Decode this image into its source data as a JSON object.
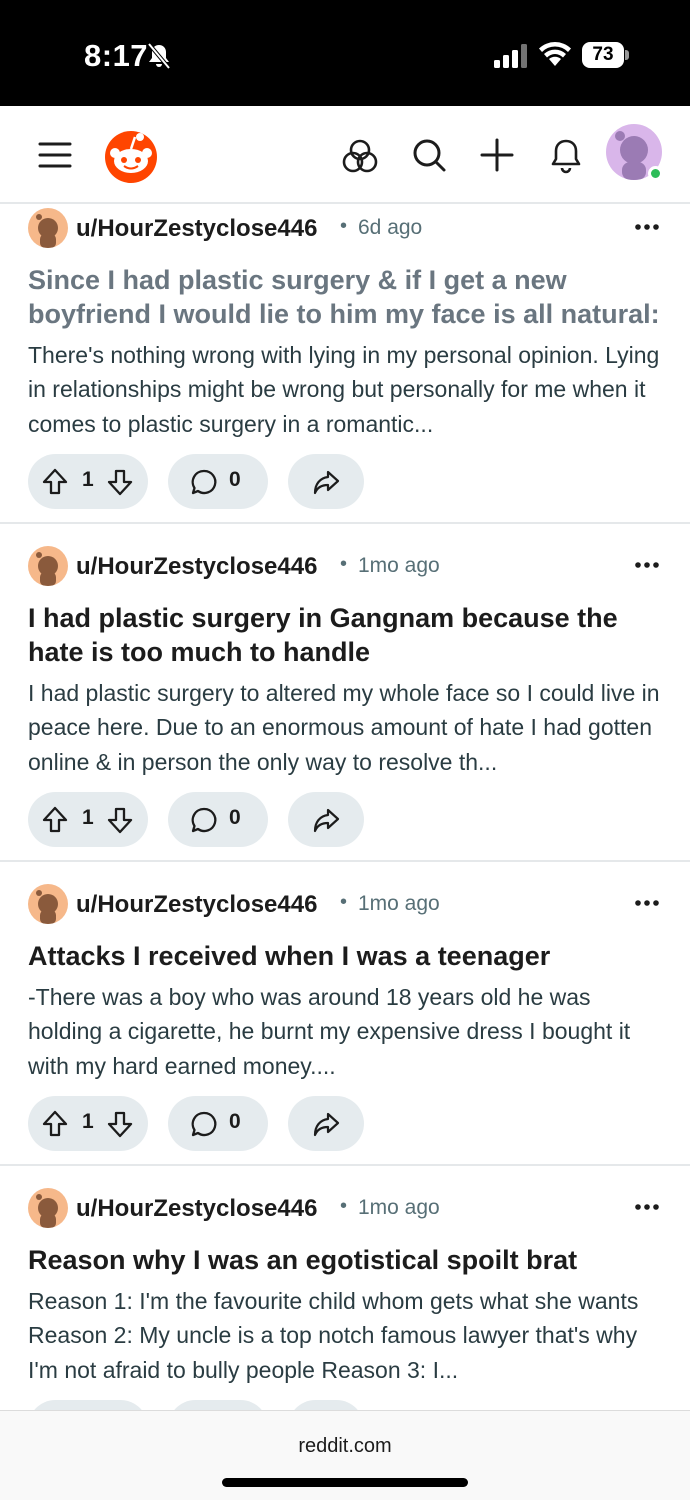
{
  "status_bar": {
    "time": "8:17",
    "battery": "73"
  },
  "header": {
    "menu_icon": "hamburger-menu-icon",
    "logo": "reddit-snoo-logo",
    "icons": [
      "explore-icon",
      "search-icon",
      "plus-icon",
      "bell-icon"
    ],
    "brand_color": "#ff4500"
  },
  "posts": [
    {
      "user": "u/HourZestyclose446",
      "time": "6d ago",
      "title": "Since I had plastic surgery & if I get a new boyfriend I would lie to him my face is all natural:",
      "body": "There's nothing wrong with lying in my personal opinion. Lying in relationships might be wrong but personally for me when it comes to plastic surgery in a romantic...",
      "votes": "1",
      "comments": "0",
      "visited": true
    },
    {
      "user": "u/HourZestyclose446",
      "time": "1mo ago",
      "title": "I had plastic surgery in Gangnam because the hate is too much to handle",
      "body": "I had plastic surgery to altered my whole face so I could live in peace here. Due to an enormous amount of hate I had gotten online & in person the only way to resolve th...",
      "votes": "1",
      "comments": "0",
      "visited": false
    },
    {
      "user": "u/HourZestyclose446",
      "time": "1mo ago",
      "title": "Attacks I received when I was a teenager",
      "body": "-There was a boy who was around 18 years old he was holding a cigarette, he burnt my expensive dress I bought it with my hard earned money....",
      "votes": "1",
      "comments": "0",
      "visited": false
    },
    {
      "user": "u/HourZestyclose446",
      "time": "1mo ago",
      "title": "Reason why I was an egotistical spoilt brat",
      "body": "Reason 1: I'm the favourite child whom gets what she wants Reason 2: My uncle is a top notch famous lawyer that's why I'm not afraid to bully people Reason 3: I...",
      "votes": "",
      "comments": "",
      "visited": false
    }
  ],
  "bottom_bar": {
    "domain": "reddit.com"
  }
}
